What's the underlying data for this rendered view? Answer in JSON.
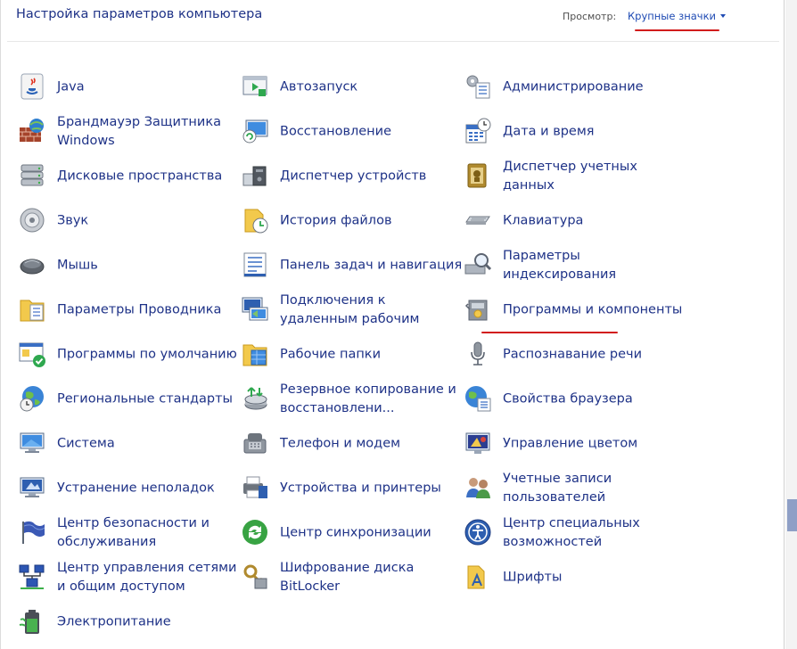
{
  "header": {
    "title": "Настройка параметров компьютера",
    "view_label": "Просмотр:",
    "view_value": "Крупные значки"
  },
  "items": [
    {
      "label": "Java",
      "icon": "java-icon",
      "col": 0,
      "row": 0
    },
    {
      "label": "Брандмауэр Защитника Windows",
      "icon": "firewall-icon",
      "col": 0,
      "row": 1
    },
    {
      "label": "Дисковые пространства",
      "icon": "storage-spaces-icon",
      "col": 0,
      "row": 2
    },
    {
      "label": "Звук",
      "icon": "speaker-icon",
      "col": 0,
      "row": 3
    },
    {
      "label": "Мышь",
      "icon": "mouse-icon",
      "col": 0,
      "row": 4
    },
    {
      "label": "Параметры Проводника",
      "icon": "folder-options-icon",
      "col": 0,
      "row": 5
    },
    {
      "label": "Программы по умолчанию",
      "icon": "default-programs-icon",
      "col": 0,
      "row": 6
    },
    {
      "label": "Региональные стандарты",
      "icon": "region-icon",
      "col": 0,
      "row": 7
    },
    {
      "label": "Система",
      "icon": "system-icon",
      "col": 0,
      "row": 8
    },
    {
      "label": "Устранение неполадок",
      "icon": "troubleshooting-icon",
      "col": 0,
      "row": 9
    },
    {
      "label": "Центр безопасности и обслуживания",
      "icon": "security-flag-icon",
      "col": 0,
      "row": 10
    },
    {
      "label": "Центр управления сетями и общим доступом",
      "icon": "network-icon",
      "col": 0,
      "row": 11
    },
    {
      "label": "Электропитание",
      "icon": "battery-icon",
      "col": 0,
      "row": 12
    },
    {
      "label": "Автозапуск",
      "icon": "autoplay-icon",
      "col": 1,
      "row": 0
    },
    {
      "label": "Восстановление",
      "icon": "recovery-icon",
      "col": 1,
      "row": 1
    },
    {
      "label": "Диспетчер устройств",
      "icon": "device-manager-icon",
      "col": 1,
      "row": 2
    },
    {
      "label": "История файлов",
      "icon": "file-history-icon",
      "col": 1,
      "row": 3
    },
    {
      "label": "Панель задач и навигация",
      "icon": "taskbar-icon",
      "col": 1,
      "row": 4
    },
    {
      "label": "Подключения к удаленным рабочим",
      "icon": "remote-desktop-icon",
      "col": 1,
      "row": 5
    },
    {
      "label": "Рабочие папки",
      "icon": "work-folders-icon",
      "col": 1,
      "row": 6
    },
    {
      "label": "Резервное копирование и восстановлени...",
      "icon": "backup-icon",
      "col": 1,
      "row": 7
    },
    {
      "label": "Телефон и модем",
      "icon": "phone-modem-icon",
      "col": 1,
      "row": 8
    },
    {
      "label": "Устройства и принтеры",
      "icon": "printer-icon",
      "col": 1,
      "row": 9
    },
    {
      "label": "Центр синхронизации",
      "icon": "sync-icon",
      "col": 1,
      "row": 10
    },
    {
      "label": "Шифрование диска BitLocker",
      "icon": "bitlocker-icon",
      "col": 1,
      "row": 11
    },
    {
      "label": "Администрирование",
      "icon": "admin-tools-icon",
      "col": 2,
      "row": 0
    },
    {
      "label": "Дата и время",
      "icon": "date-time-icon",
      "col": 2,
      "row": 1
    },
    {
      "label": "Диспетчер учетных данных",
      "icon": "credential-manager-icon",
      "col": 2,
      "row": 2
    },
    {
      "label": "Клавиатура",
      "icon": "keyboard-icon",
      "col": 2,
      "row": 3
    },
    {
      "label": "Параметры индексирования",
      "icon": "indexing-icon",
      "col": 2,
      "row": 4
    },
    {
      "label": "Программы и компоненты",
      "icon": "programs-features-icon",
      "col": 2,
      "row": 5
    },
    {
      "label": "Распознавание речи",
      "icon": "microphone-icon",
      "col": 2,
      "row": 6
    },
    {
      "label": "Свойства браузера",
      "icon": "internet-options-icon",
      "col": 2,
      "row": 7
    },
    {
      "label": "Управление цветом",
      "icon": "color-management-icon",
      "col": 2,
      "row": 8
    },
    {
      "label": "Учетные записи пользователей",
      "icon": "user-accounts-icon",
      "col": 2,
      "row": 9
    },
    {
      "label": "Центр специальных возможностей",
      "icon": "ease-of-access-icon",
      "col": 2,
      "row": 10
    },
    {
      "label": "Шрифты",
      "icon": "fonts-icon",
      "col": 2,
      "row": 11
    }
  ]
}
